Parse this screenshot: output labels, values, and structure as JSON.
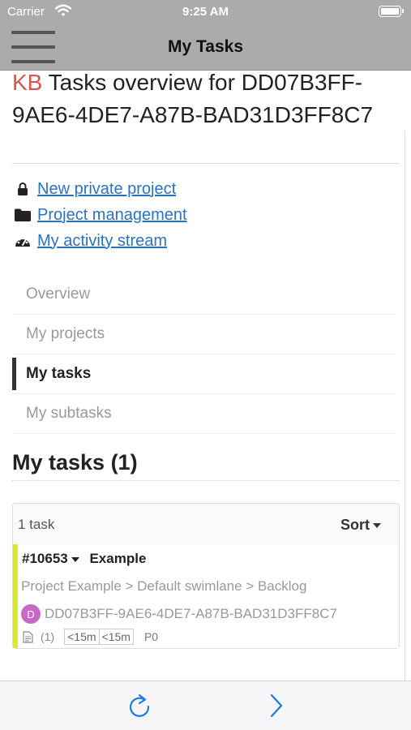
{
  "status_bar": {
    "carrier": "Carrier",
    "time": "9:25 AM"
  },
  "nav": {
    "title": "My Tasks",
    "menu_icon": "hamburger-menu-icon"
  },
  "page": {
    "logo": "KB",
    "title": " Tasks overview for DD07B3FF-9AE6-4DE7-A87B-BAD31D3FF8C7"
  },
  "actions": [
    {
      "label": "New private project",
      "icon": "lock-icon"
    },
    {
      "label": "Project management",
      "icon": "folder-icon"
    },
    {
      "label": "My activity stream",
      "icon": "dashboard-icon"
    }
  ],
  "menu": [
    {
      "label": "Overview",
      "active": false
    },
    {
      "label": "My projects",
      "active": false
    },
    {
      "label": "My tasks",
      "active": true
    },
    {
      "label": "My subtasks",
      "active": false
    }
  ],
  "section": {
    "title": "My tasks (1)"
  },
  "task_list": {
    "count_label": "1 task",
    "sort_label": "Sort",
    "tasks": [
      {
        "id": "#10653",
        "title": "Example",
        "path": "Project Example > Default swimlane > Backlog",
        "avatar_letter": "D",
        "avatar_color": "#c868c7",
        "assignee": "DD07B3FF-9AE6-4DE7-A87B-BAD31D3FF8C7",
        "file_count": "(1)",
        "time_estimated": "<15m",
        "time_spent": "<15m",
        "priority": "P0",
        "color": "#d6e83a"
      }
    ]
  },
  "toolbar": {
    "refresh_icon": "refresh-icon",
    "next_icon": "chevron-right-icon"
  },
  "colors": {
    "bar": "#ababab",
    "link": "#2c72c2",
    "ios_blue": "#1a7ae0"
  }
}
